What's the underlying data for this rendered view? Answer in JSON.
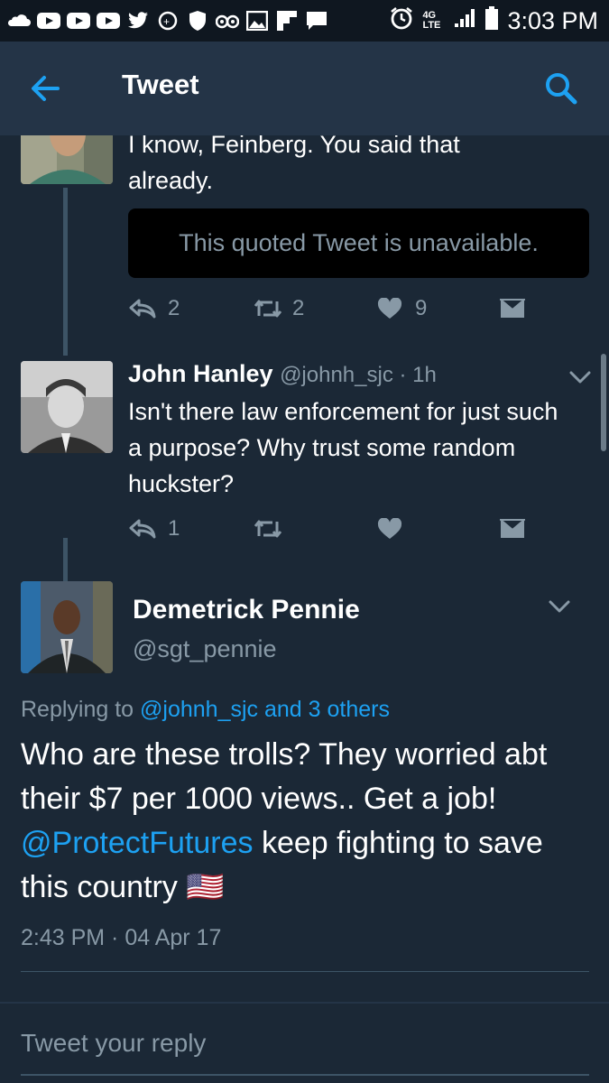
{
  "status_bar": {
    "network": "4G LTE",
    "time": "3:03 PM",
    "notification_icons": [
      "soundcloud-icon",
      "youtube-icon",
      "youtube-icon",
      "youtube-icon",
      "twitter-icon",
      "tapatalk-icon",
      "shield-icon",
      "tripadvisor-icon",
      "gallery-icon",
      "flipboard-icon",
      "message-icon"
    ]
  },
  "header": {
    "title": "Tweet"
  },
  "tweet1": {
    "text": "I know, Feinberg. You said that already.",
    "quoted": "This quoted Tweet is unavailable.",
    "replies": "2",
    "retweets": "2",
    "likes": "9"
  },
  "tweet2": {
    "name": "John Hanley",
    "handle": "@johnh_sjc",
    "time": "1h",
    "text": "Isn't there law enforcement for just such a purpose? Why trust some random huckster?",
    "replies": "1"
  },
  "main_tweet": {
    "name": "Demetrick Pennie",
    "handle": "@sgt_pennie",
    "replying_prefix": "Replying to",
    "replying_to": "@johnh_sjc and 3 others",
    "text_part1": "Who are these trolls? They worried abt their $7 per 1000 views.. Get a job!",
    "mention": "@ProtectFutures",
    "text_part2": "keep fighting to save this country",
    "flag": "🇺🇸",
    "timestamp": "2:43 PM · 04 Apr 17"
  },
  "reply_bar": {
    "placeholder": "Tweet your reply"
  },
  "colors": {
    "background": "#1b2836",
    "header": "#243447",
    "accent": "#1da1f2",
    "muted": "#8899a6"
  }
}
